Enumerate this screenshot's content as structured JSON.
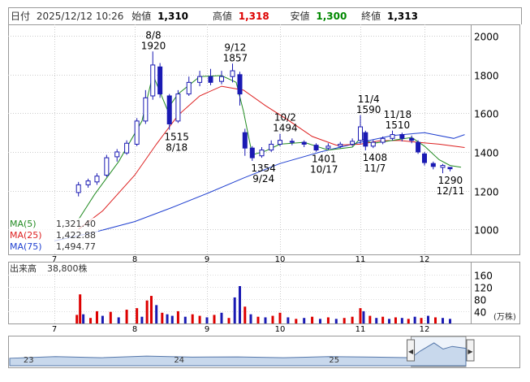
{
  "header": {
    "date_label": "日付",
    "datetime": "2025/12/12 10:26",
    "open_label": "始値",
    "open": "1,310",
    "high_label": "高値",
    "high": "1,318",
    "low_label": "安値",
    "low": "1,300",
    "close_label": "終値",
    "close": "1,313"
  },
  "colors": {
    "high": "#dd0000",
    "low": "#008800",
    "candle": "#1a1ab3",
    "ma5": "#228b22",
    "ma25": "#dd2020",
    "ma75": "#2040d0",
    "vol_up": "#dd0000",
    "vol_down": "#1a1ab3",
    "navigator_fill": "#c8d8ec"
  },
  "chart_data": [
    {
      "type": "candlestick",
      "x_labels": [
        "7",
        "8",
        "9",
        "10",
        "11",
        "12"
      ],
      "ylim": [
        870,
        2060
      ],
      "y_ticks": [
        1000,
        1200,
        1400,
        1600,
        1800,
        2000
      ],
      "grid": true,
      "annotations": [
        {
          "date": "8/8",
          "value": "1920",
          "kind": "high"
        },
        {
          "date": "8/18",
          "value": "1515",
          "kind": "low"
        },
        {
          "date": "9/12",
          "value": "1857",
          "kind": "high"
        },
        {
          "date": "9/24",
          "value": "1354",
          "kind": "low"
        },
        {
          "date": "10/2",
          "value": "1494",
          "kind": "high"
        },
        {
          "date": "10/17",
          "value": "1401",
          "kind": "low"
        },
        {
          "date": "11/4",
          "value": "1590",
          "kind": "high"
        },
        {
          "date": "11/7",
          "value": "1408",
          "kind": "low"
        },
        {
          "date": "11/18",
          "value": "1510",
          "kind": "high"
        },
        {
          "date": "12/11",
          "value": "1290",
          "kind": "low"
        }
      ],
      "legend": [
        {
          "name": "MA(5)",
          "value": "1,321.40"
        },
        {
          "name": "MA(25)",
          "value": "1,422.88"
        },
        {
          "name": "MA(75)",
          "value": "1,494.77"
        }
      ],
      "ma75": [
        [
          7.0,
          940
        ],
        [
          7.5,
          985
        ],
        [
          8.0,
          1040
        ],
        [
          8.5,
          1110
        ],
        [
          9.0,
          1185
        ],
        [
          9.5,
          1265
        ],
        [
          10.0,
          1340
        ],
        [
          10.5,
          1400
        ],
        [
          11.0,
          1450
        ],
        [
          11.5,
          1485
        ],
        [
          12.0,
          1500
        ],
        [
          12.4,
          1470
        ],
        [
          12.55,
          1490
        ]
      ],
      "ma25": [
        [
          7.3,
          1000
        ],
        [
          7.6,
          1095
        ],
        [
          8.0,
          1280
        ],
        [
          8.3,
          1440
        ],
        [
          8.6,
          1590
        ],
        [
          8.9,
          1690
        ],
        [
          9.2,
          1740
        ],
        [
          9.5,
          1720
        ],
        [
          9.8,
          1640
        ],
        [
          10.1,
          1565
        ],
        [
          10.4,
          1480
        ],
        [
          10.7,
          1435
        ],
        [
          11.0,
          1440
        ],
        [
          11.3,
          1458
        ],
        [
          11.6,
          1460
        ],
        [
          11.9,
          1450
        ],
        [
          12.2,
          1440
        ],
        [
          12.55,
          1423
        ]
      ],
      "ma5": [
        [
          7.3,
          1050
        ],
        [
          7.5,
          1180
        ],
        [
          7.8,
          1350
        ],
        [
          8.1,
          1560
        ],
        [
          8.25,
          1800
        ],
        [
          8.45,
          1620
        ],
        [
          8.6,
          1700
        ],
        [
          8.9,
          1790
        ],
        [
          9.2,
          1795
        ],
        [
          9.4,
          1760
        ],
        [
          9.5,
          1610
        ],
        [
          9.62,
          1385
        ],
        [
          9.8,
          1405
        ],
        [
          10.0,
          1440
        ],
        [
          10.3,
          1450
        ],
        [
          10.6,
          1410
        ],
        [
          10.9,
          1425
        ],
        [
          11.0,
          1470
        ],
        [
          11.2,
          1445
        ],
        [
          11.5,
          1460
        ],
        [
          11.8,
          1475
        ],
        [
          12.0,
          1430
        ],
        [
          12.2,
          1360
        ],
        [
          12.35,
          1330
        ],
        [
          12.5,
          1321
        ]
      ],
      "candles": [
        [
          7.3,
          1190,
          1230,
          1170,
          1245
        ],
        [
          7.42,
          1230,
          1250,
          1215,
          1262
        ],
        [
          7.53,
          1245,
          1275,
          1230,
          1290
        ],
        [
          7.65,
          1280,
          1370,
          1270,
          1385
        ],
        [
          7.78,
          1375,
          1400,
          1350,
          1415
        ],
        [
          7.9,
          1395,
          1445,
          1385,
          1460
        ],
        [
          8.03,
          1440,
          1560,
          1430,
          1575
        ],
        [
          8.15,
          1560,
          1680,
          1545,
          1720
        ],
        [
          8.25,
          1690,
          1850,
          1670,
          1920
        ],
        [
          8.35,
          1840,
          1700,
          1680,
          1860
        ],
        [
          8.48,
          1690,
          1545,
          1515,
          1700
        ],
        [
          8.6,
          1560,
          1700,
          1550,
          1720
        ],
        [
          8.75,
          1700,
          1760,
          1690,
          1790
        ],
        [
          8.9,
          1760,
          1790,
          1740,
          1820
        ],
        [
          9.05,
          1790,
          1760,
          1745,
          1830
        ],
        [
          9.2,
          1765,
          1790,
          1750,
          1820
        ],
        [
          9.35,
          1790,
          1820,
          1760,
          1857
        ],
        [
          9.45,
          1800,
          1700,
          1640,
          1815
        ],
        [
          9.52,
          1500,
          1420,
          1380,
          1520
        ],
        [
          9.62,
          1420,
          1370,
          1354,
          1430
        ],
        [
          9.75,
          1380,
          1410,
          1370,
          1425
        ],
        [
          9.88,
          1410,
          1440,
          1400,
          1460
        ],
        [
          10.0,
          1440,
          1460,
          1430,
          1494
        ],
        [
          10.15,
          1455,
          1450,
          1435,
          1470
        ],
        [
          10.3,
          1450,
          1440,
          1425,
          1460
        ],
        [
          10.45,
          1435,
          1410,
          1401,
          1445
        ],
        [
          10.6,
          1420,
          1430,
          1410,
          1445
        ],
        [
          10.75,
          1430,
          1440,
          1420,
          1452
        ],
        [
          10.9,
          1440,
          1455,
          1430,
          1470
        ],
        [
          11.0,
          1460,
          1530,
          1440,
          1590
        ],
        [
          11.08,
          1500,
          1430,
          1408,
          1510
        ],
        [
          11.2,
          1430,
          1450,
          1420,
          1462
        ],
        [
          11.35,
          1450,
          1470,
          1440,
          1480
        ],
        [
          11.5,
          1470,
          1490,
          1460,
          1510
        ],
        [
          11.65,
          1490,
          1470,
          1455,
          1500
        ],
        [
          11.8,
          1470,
          1460,
          1445,
          1485
        ],
        [
          11.9,
          1450,
          1400,
          1390,
          1460
        ],
        [
          12.0,
          1390,
          1345,
          1330,
          1400
        ],
        [
          12.12,
          1340,
          1325,
          1310,
          1350
        ],
        [
          12.25,
          1320,
          1330,
          1290,
          1338
        ],
        [
          12.35,
          1320,
          1313,
          1300,
          1318
        ]
      ]
    },
    {
      "type": "bar",
      "title": "出来高",
      "current": "38,800株",
      "unit": "(万株)",
      "ylim": [
        0,
        175
      ],
      "y_ticks": [
        40,
        80,
        120,
        160
      ],
      "x_labels": [
        "7",
        "8",
        "9",
        "10",
        "11",
        "12"
      ],
      "bars": [
        [
          7.28,
          28,
          "u"
        ],
        [
          7.32,
          95,
          "u"
        ],
        [
          7.36,
          30,
          "d"
        ],
        [
          7.45,
          18,
          "u"
        ],
        [
          7.53,
          40,
          "u"
        ],
        [
          7.6,
          25,
          "d"
        ],
        [
          7.7,
          38,
          "u"
        ],
        [
          7.8,
          20,
          "d"
        ],
        [
          7.9,
          45,
          "u"
        ],
        [
          8.03,
          50,
          "u"
        ],
        [
          8.1,
          22,
          "d"
        ],
        [
          8.17,
          75,
          "u"
        ],
        [
          8.23,
          90,
          "u"
        ],
        [
          8.3,
          60,
          "d"
        ],
        [
          8.38,
          35,
          "u"
        ],
        [
          8.45,
          30,
          "d"
        ],
        [
          8.52,
          25,
          "d"
        ],
        [
          8.6,
          40,
          "u"
        ],
        [
          8.7,
          22,
          "d"
        ],
        [
          8.8,
          30,
          "u"
        ],
        [
          8.9,
          25,
          "u"
        ],
        [
          9.0,
          20,
          "d"
        ],
        [
          9.1,
          28,
          "u"
        ],
        [
          9.2,
          35,
          "d"
        ],
        [
          9.3,
          18,
          "u"
        ],
        [
          9.38,
          85,
          "d"
        ],
        [
          9.45,
          122,
          "d"
        ],
        [
          9.52,
          55,
          "u"
        ],
        [
          9.6,
          30,
          "d"
        ],
        [
          9.7,
          22,
          "u"
        ],
        [
          9.8,
          20,
          "d"
        ],
        [
          9.9,
          25,
          "u"
        ],
        [
          10.0,
          35,
          "u"
        ],
        [
          10.1,
          20,
          "d"
        ],
        [
          10.2,
          15,
          "u"
        ],
        [
          10.3,
          18,
          "d"
        ],
        [
          10.4,
          22,
          "u"
        ],
        [
          10.5,
          15,
          "d"
        ],
        [
          10.6,
          20,
          "u"
        ],
        [
          10.7,
          15,
          "d"
        ],
        [
          10.8,
          18,
          "u"
        ],
        [
          10.9,
          22,
          "u"
        ],
        [
          11.0,
          50,
          "u"
        ],
        [
          11.05,
          40,
          "d"
        ],
        [
          11.15,
          25,
          "u"
        ],
        [
          11.25,
          18,
          "d"
        ],
        [
          11.35,
          22,
          "u"
        ],
        [
          11.45,
          15,
          "d"
        ],
        [
          11.55,
          20,
          "u"
        ],
        [
          11.65,
          18,
          "d"
        ],
        [
          11.75,
          15,
          "u"
        ],
        [
          11.85,
          22,
          "d"
        ],
        [
          11.95,
          18,
          "u"
        ],
        [
          12.05,
          25,
          "d"
        ],
        [
          12.15,
          20,
          "u"
        ],
        [
          12.25,
          18,
          "d"
        ],
        [
          12.35,
          15,
          "d"
        ]
      ]
    },
    {
      "type": "area",
      "title": "navigator",
      "x_labels": [
        "23",
        "24",
        "25"
      ],
      "series": [
        [
          0,
          0.28
        ],
        [
          0.1,
          0.34
        ],
        [
          0.2,
          0.3
        ],
        [
          0.3,
          0.36
        ],
        [
          0.4,
          0.32
        ],
        [
          0.5,
          0.33
        ],
        [
          0.6,
          0.3
        ],
        [
          0.7,
          0.34
        ],
        [
          0.8,
          0.32
        ],
        [
          0.88,
          0.3
        ],
        [
          0.9,
          0.55
        ],
        [
          0.93,
          0.85
        ],
        [
          0.95,
          0.62
        ],
        [
          0.97,
          0.72
        ],
        [
          1.0,
          0.65
        ]
      ],
      "selection": [
        0.88,
        1.0
      ]
    }
  ]
}
